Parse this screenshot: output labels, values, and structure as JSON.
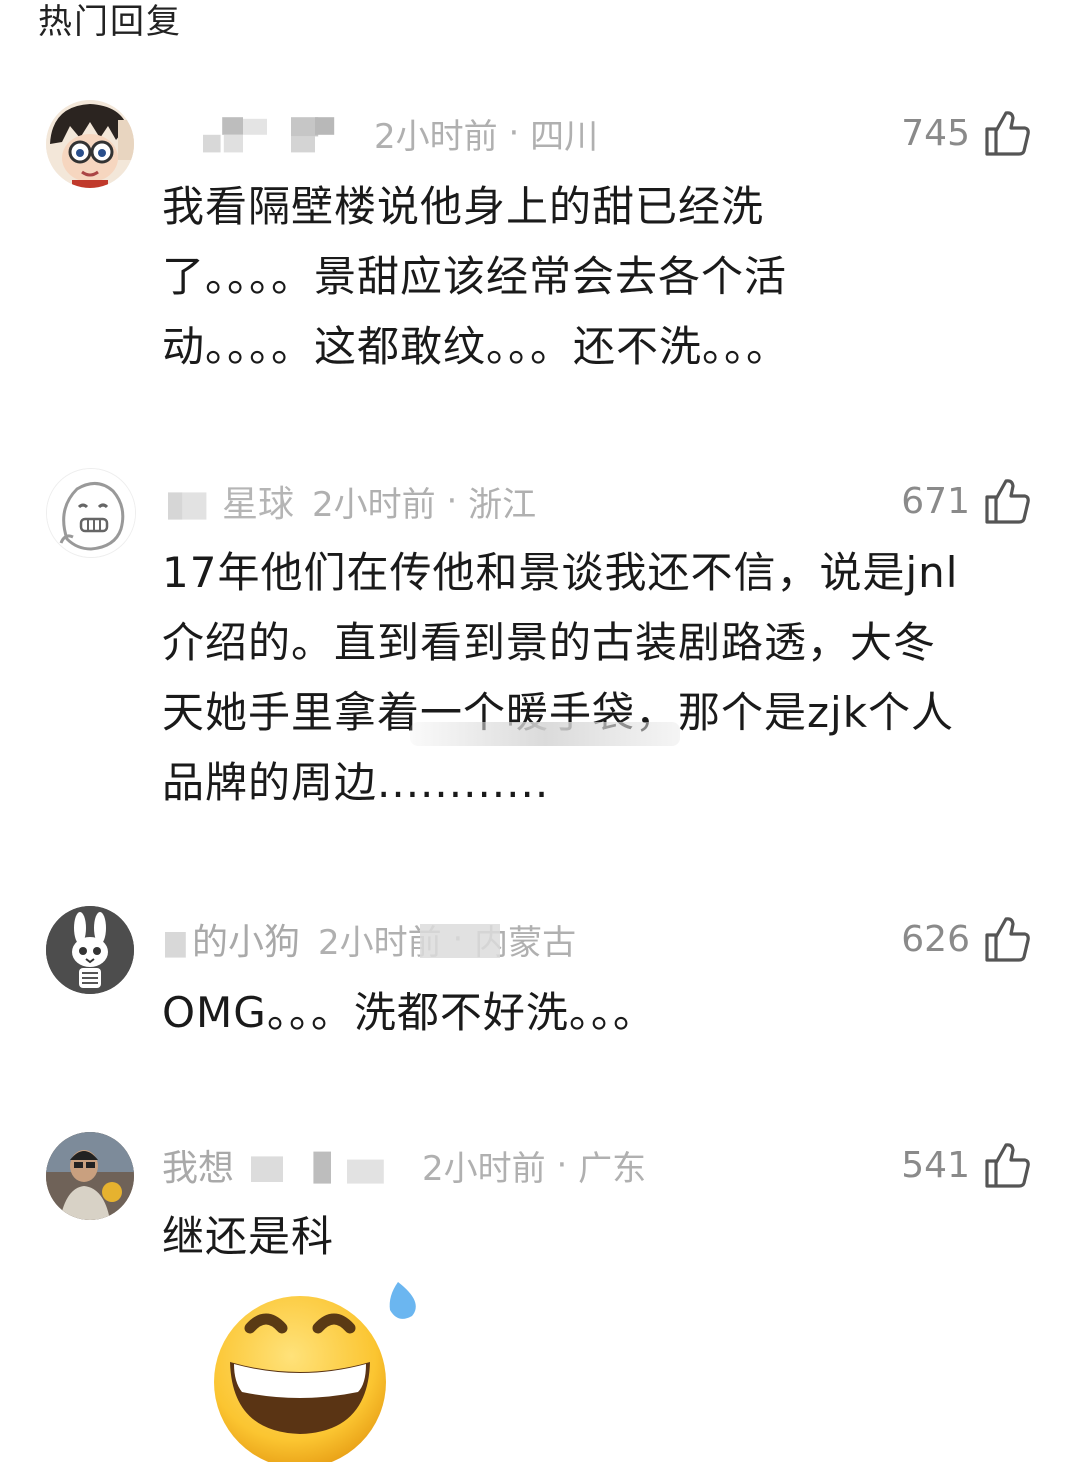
{
  "section": {
    "title": "热门回复"
  },
  "comments": [
    {
      "username": "",
      "time": "2小时前",
      "location": "四川",
      "likes": "745",
      "lines": [
        "我看隔壁楼说他身上的甜已经洗",
        "了。。。。景甜应该经常会去各个活",
        "动。。。。这都敢纹。。。还不洗。。。"
      ],
      "avatar_icon": "detective-avatar"
    },
    {
      "username": "星球",
      "time": "2小时前",
      "location": "浙江",
      "likes": "671",
      "lines": [
        "17年他们在传他和景谈我还不信，说是jnl",
        "介绍的。直到看到景的古装剧路透，大冬",
        "天她手里拿着一个暖手袋，那个是zjk个人",
        "品牌的周边............"
      ],
      "avatar_icon": "cartoon-face-avatar"
    },
    {
      "username": "的小狗",
      "time": "2小时前",
      "location": "内蒙古",
      "likes": "626",
      "lines": [
        "OMG。。。洗都不好洗。。。"
      ],
      "avatar_icon": "skeleton-bunny-avatar"
    },
    {
      "username": "我想",
      "time": "2小时前",
      "location": "广东",
      "likes": "541",
      "lines": [
        "继还是科"
      ],
      "avatar_icon": "photo-avatar",
      "emoji": "grinning-sweat-emoji"
    }
  ],
  "colors": {
    "meta": "#b0b0b0",
    "text": "#1a1a1a",
    "like": "#8a8a8a"
  }
}
